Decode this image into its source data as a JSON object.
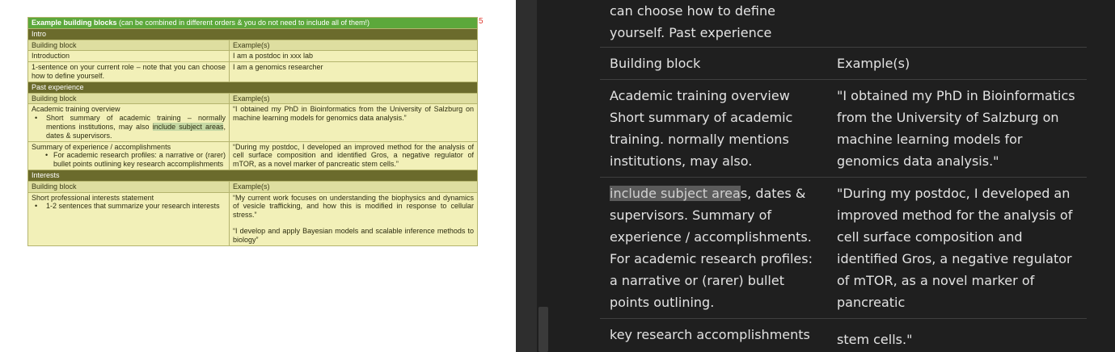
{
  "document": {
    "page_number": "5",
    "banner": {
      "bold": "Example building blocks",
      "rest": " (can be combined in different orders & you do not need to include all of them!)"
    },
    "col_headers": {
      "block": "Building block",
      "example": "Example(s)"
    },
    "intro": {
      "title": "Intro",
      "rows": [
        {
          "block": "Introduction",
          "example": "I am a postdoc in xxx lab"
        },
        {
          "block": "1-sentence on your current role – note that you can choose how to define yourself.",
          "example": "I am a genomics researcher"
        }
      ]
    },
    "past": {
      "title": "Past experience",
      "row1": {
        "block_title": "Academic training overview",
        "bullet": "•",
        "bullet_pre": "Short summary of academic training – normally mentions institutions, may also ",
        "bullet_hl": "include subject areas",
        "bullet_post": ", dates & supervisors.",
        "example": "“I obtained my PhD in Bioinformatics from the University of Salzburg on machine learning models for genomics data analysis.”"
      },
      "row2": {
        "block_title": "Summary of experience / accomplishments",
        "bullet": "•",
        "bullet_text": "For academic research profiles: a narrative or (rarer) bullet points outlining key research accomplishments",
        "example": "“During my postdoc, I developed an improved method for the analysis of cell surface composition and identified Gros, a negative regulator of mTOR, as a novel marker of pancreatic stem cells.”"
      }
    },
    "interests": {
      "title": "Interests",
      "row1": {
        "block_title": "Short professional interests statement",
        "bullet": "•",
        "bullet_text": "1-2 sentences that summarize your research interests",
        "example1": "“My current work focuses on understanding the biophysics and dynamics of vesicle trafficking, and how this is modified in response to cellular stress.”",
        "example2": "“I develop and apply Bayesian models and scalable inference methods to biology”"
      }
    }
  },
  "reader": {
    "lead_line1": "can choose how to define",
    "lead_line2": "yourself. Past experience",
    "header_left": "Building block",
    "header_right": "Example(s)",
    "row1_left": "Academic training overview Short summary of academic training. normally mentions institutions, may also.",
    "row1_right": "\"I obtained my PhD in Bioinformatics from the University of Salzburg on machine learning models for genomics data analysis.\"",
    "row2_selected": "include subject area",
    "row2_left_rest": "s, dates & supervisors. Summary of experience / accomplishments. For academic research profiles: a narrative or (rarer) bullet points outlining.",
    "row2_right": "\"During my postdoc, I developed an improved method for the analysis of cell surface composition and identified Gros, a negative regulator of mTOR, as a novel marker of pancreatic",
    "row3_left": "key research accomplishments",
    "row3_right": "stem cells.\""
  },
  "colors": {
    "banner_green": "#5ca83b",
    "section_olive": "#6b6b2c",
    "cell_yellow": "#f2f0b8",
    "header_tan": "#dedea0",
    "highlight_green": "#c5d8a4",
    "reader_bg": "#1f1f1f",
    "reader_text": "#e3e3e3",
    "page_number_red": "#e03c31"
  }
}
